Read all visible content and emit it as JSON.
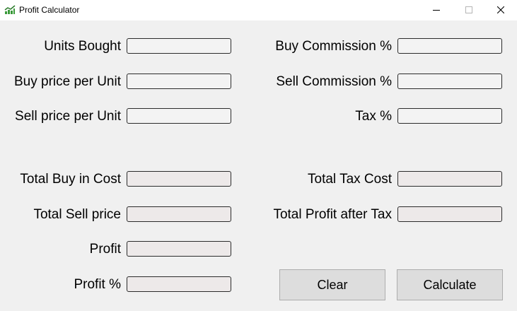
{
  "window": {
    "title": "Profit Calculator",
    "icon": "chart-icon"
  },
  "inputs": {
    "units_bought": {
      "label": "Units Bought",
      "value": ""
    },
    "buy_price": {
      "label": "Buy price per Unit",
      "value": ""
    },
    "sell_price": {
      "label": "Sell price per Unit",
      "value": ""
    },
    "buy_commission": {
      "label": "Buy Commission %",
      "value": ""
    },
    "sell_commission": {
      "label": "Sell Commission %",
      "value": ""
    },
    "tax": {
      "label": "Tax %",
      "value": ""
    }
  },
  "outputs": {
    "total_buy_cost": {
      "label": "Total Buy in Cost",
      "value": ""
    },
    "total_sell_price": {
      "label": "Total Sell price",
      "value": ""
    },
    "profit": {
      "label": "Profit",
      "value": ""
    },
    "profit_pct": {
      "label": "Profit %",
      "value": ""
    },
    "total_tax_cost": {
      "label": "Total Tax Cost",
      "value": ""
    },
    "total_profit_after_tax": {
      "label": "Total Profit after Tax",
      "value": ""
    }
  },
  "actions": {
    "clear_label": "Clear",
    "calculate_label": "Calculate"
  },
  "colors": {
    "window_bg": "#f0f0f0",
    "titlebar_bg": "#ffffff",
    "icon_green": "#3a9a3a",
    "input_bg": "#f3f3f3",
    "readonly_bg": "#ede9e9",
    "button_bg": "#dddddd"
  }
}
